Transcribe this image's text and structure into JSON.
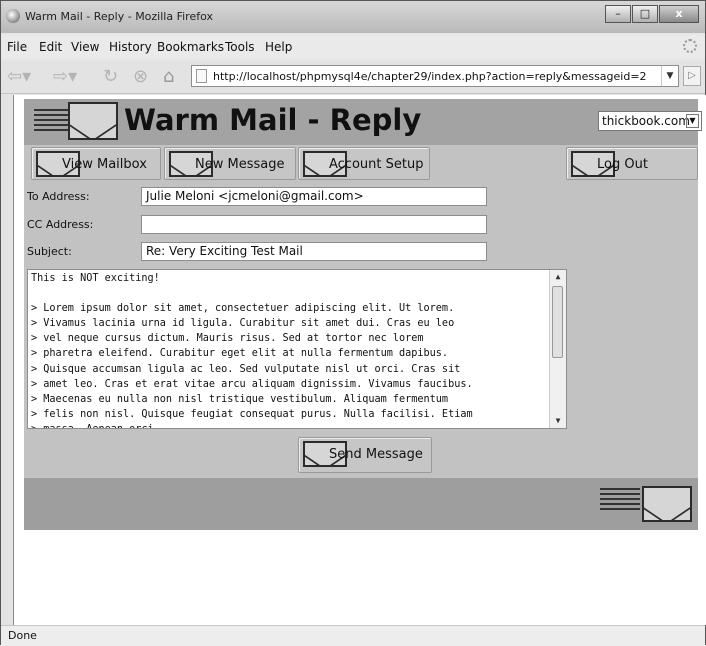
{
  "window": {
    "title": "Warm Mail - Reply - Mozilla Firefox",
    "controls": {
      "minimize": "–",
      "maximize": "□",
      "close": "x"
    }
  },
  "menu": [
    "File",
    "Edit",
    "View",
    "History",
    "Bookmarks",
    "Tools",
    "Help"
  ],
  "nav": {
    "url": "http://localhost/phpmysql4e/chapter29/index.php?action=reply&messageid=2",
    "icons": [
      "back-arrow-icon",
      "forward-arrow-icon",
      "reload-icon",
      "stop-icon",
      "home-icon"
    ]
  },
  "app": {
    "title": "Warm Mail - Reply",
    "account_select": "thickbook.com",
    "buttons": {
      "view_mailbox": "View Mailbox",
      "new_message": "New Message",
      "account_setup": "Account Setup",
      "log_out": "Log Out",
      "send_message": "Send Message"
    }
  },
  "form": {
    "to_label": "To Address:",
    "to_value": "Julie Meloni <jcmeloni@gmail.com>",
    "cc_label": "CC Address:",
    "cc_value": "",
    "subject_label": "Subject:",
    "subject_value": "Re: Very Exciting Test Mail",
    "message": "This is NOT exciting!\n\n> Lorem ipsum dolor sit amet, consectetuer adipiscing elit. Ut lorem.\n> Vivamus lacinia urna id ligula. Curabitur sit amet dui. Cras eu leo\n> vel neque cursus dictum. Mauris risus. Sed at tortor nec lorem\n> pharetra eleifend. Curabitur eget elit at nulla fermentum dapibus.\n> Quisque accumsan ligula ac leo. Sed vulputate nisl ut orci. Cras sit\n> amet leo. Cras et erat vitae arcu aliquam dignissim. Vivamus faucibus.\n> Maecenas eu nulla non nisl tristique vestibulum. Aliquam fermentum\n> felis non nisl. Quisque feugiat consequat purus. Nulla facilisi. Etiam\n> massa. Aenean orci."
  },
  "status": "Done"
}
